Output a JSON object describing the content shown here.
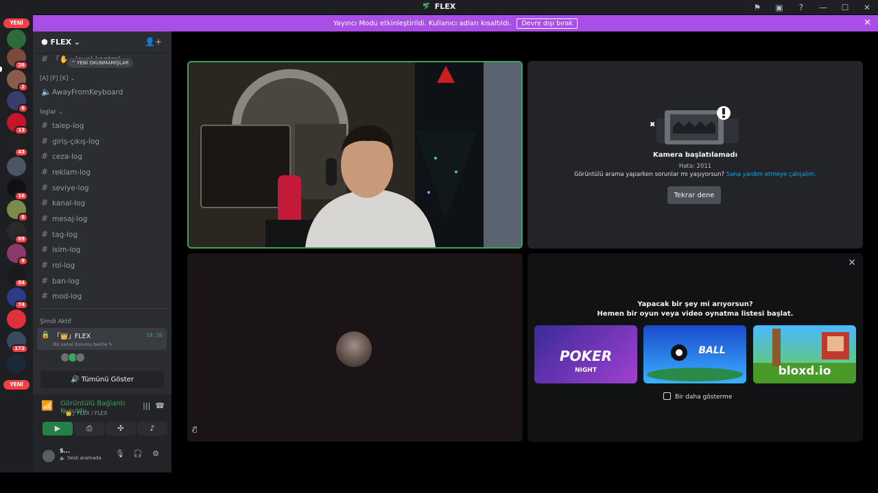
{
  "titlebar": {
    "title": "FLEX"
  },
  "banner": {
    "text": "Yayıncı Modu etkinleştirildi. Kullanıcı adları kısaltıldı.",
    "button": "Devre dışı bırak"
  },
  "guilds": {
    "new_top": "YENİ",
    "new_bottom": "YENİ",
    "badges": [
      "26",
      "2",
      "6",
      "13",
      "43",
      "16",
      "6",
      "69",
      "9",
      "64",
      "74",
      "172"
    ]
  },
  "sidebar": {
    "server_name": "FLEX",
    "new_unread": "YENİ OKUNMAMIŞLAR",
    "partial_channel": "level-kontrol",
    "cat_afk": "[A] [F] [K]",
    "afk_channel": "AwayFromKeyboard",
    "cat_logs": "loglar",
    "channels": [
      "talep-log",
      "giriş-çıkış-log",
      "ceza-log",
      "reklam-log",
      "seviye-log",
      "kanal-log",
      "mesaj-log",
      "tag-log",
      "isim-log",
      "rol-log",
      "ban-log",
      "mod-log"
    ],
    "now_active": "Şimdi Aktif",
    "active": {
      "name": "FLEX",
      "time": "10:36",
      "desc": "Bir kanal durumu belirle"
    },
    "show_all": "Tümünü Göster"
  },
  "voice": {
    "title": "Görüntülü Bağlantı Kuruldu",
    "sub": "FLEX / FLEX"
  },
  "user": {
    "name": "S...",
    "status": "Sesli aramada"
  },
  "camera_error": {
    "title": "Kamera başlatılamadı",
    "code": "Hata: 2011",
    "help": "Görüntülü arama yaparken sorunlar mı yaşıyorsun?",
    "help_link": "Sana yardım etmeye çalışalım.",
    "retry": "Tekrar dene"
  },
  "activities": {
    "line1": "Yapacak bir şey mi arıyorsun?",
    "line2": "Hemen bir oyun veya video oynatma listesi başlat.",
    "cards": [
      "POKER",
      "BALL",
      "bloxd.io"
    ],
    "poker_sub": "NIGHT",
    "dont_show": "Bir daha gösterme"
  },
  "colors": {
    "accent": "#a94ee6",
    "green": "#3ba55c",
    "danger": "#f23f43"
  }
}
